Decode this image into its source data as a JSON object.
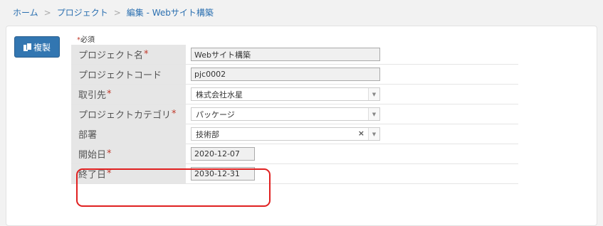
{
  "breadcrumb": {
    "home": "ホーム",
    "project": "プロジェクト",
    "current": "編集 - Webサイト構築",
    "separator": ">"
  },
  "toolbar": {
    "copy_label": "複製",
    "copy_icon": "copy-icon"
  },
  "form": {
    "required_note_star": "*",
    "required_note_text": "必須",
    "required_star": "*",
    "fields": {
      "project_name": {
        "label": "プロジェクト名",
        "value": "Webサイト構築"
      },
      "project_code": {
        "label": "プロジェクトコード",
        "value": "pjc0002"
      },
      "client": {
        "label": "取引先",
        "value": "株式会社水星"
      },
      "category": {
        "label": "プロジェクトカテゴリ",
        "value": "パッケージ"
      },
      "department": {
        "label": "部署",
        "value": "技術部",
        "clear": "×"
      },
      "start_date": {
        "label": "開始日",
        "value": "2020-12-07"
      },
      "end_date": {
        "label": "終了日",
        "value": "2030-12-31"
      }
    },
    "select_arrow": "▼"
  },
  "colors": {
    "accent": "#3276b1",
    "required": "#c0392b",
    "highlight": "#e02020"
  }
}
